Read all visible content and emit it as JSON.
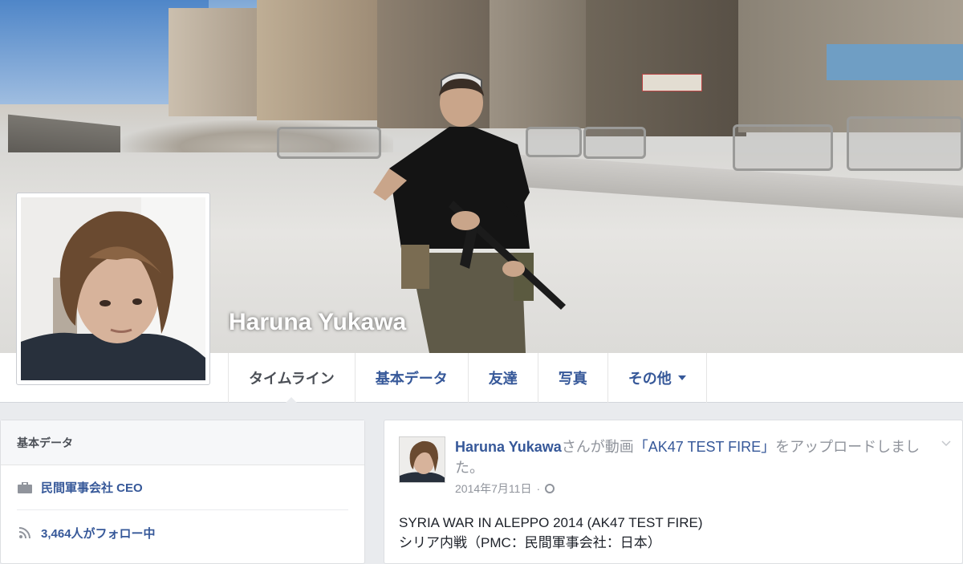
{
  "profile": {
    "name": "Haruna Yukawa"
  },
  "nav": {
    "tabs": [
      {
        "label": "タイムライン",
        "active": true
      },
      {
        "label": "基本データ"
      },
      {
        "label": "友達"
      },
      {
        "label": "写真"
      },
      {
        "label": "その他"
      }
    ]
  },
  "about": {
    "title": "基本データ",
    "items": [
      {
        "icon": "briefcase-icon",
        "text": "民間軍事会社 CEO"
      },
      {
        "icon": "rss-icon",
        "text": "3,464人がフォロー中"
      }
    ]
  },
  "post": {
    "author": "Haruna Yukawa",
    "action_prefix": "さんが動画",
    "video_title": "「AK47 TEST FIRE」",
    "action_suffix": "をアップロードしました。",
    "date": "2014年7月11日",
    "dot": "·",
    "body_line1": "SYRIA WAR IN ALEPPO 2014 (AK47 TEST FIRE)",
    "body_line2": "シリア内戦（PMC：民間軍事会社：日本）"
  },
  "colors": {
    "link": "#365899",
    "background": "#e9ebee",
    "muted": "#90949c"
  }
}
